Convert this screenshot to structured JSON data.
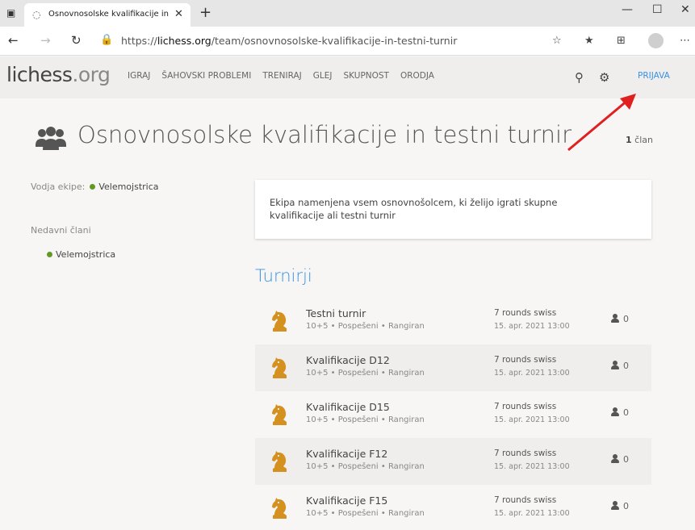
{
  "browser": {
    "tab_title": "Osnovnosolske kvalifikacije in testni turnir - lichess.org",
    "url_prefix": "https://",
    "url_host": "lichess.org",
    "url_path": "/team/osnovnosolske-kvalifikacije-in-testni-turnir",
    "icons": [
      "tab-actions-icon",
      "tab-favicon-icon",
      "close-icon",
      "plus-icon",
      "minimize-icon",
      "maximize-icon",
      "close-window-icon",
      "back-icon",
      "forward-icon",
      "refresh-icon",
      "lock-icon",
      "read-aloud-icon",
      "favorites-icon",
      "collections-icon",
      "profile-icon",
      "more-icon"
    ]
  },
  "header": {
    "logo_main": "lichess",
    "logo_tld": ".org",
    "nav": [
      "IGRAJ",
      "ŠAHOVSKI PROBLEMI",
      "TRENIRAJ",
      "GLEJ",
      "SKUPNOST",
      "ORODJA"
    ],
    "signin": "PRIJAVA"
  },
  "team": {
    "title": "Osnovnosolske kvalifikacije in testni turnir",
    "member_count": "1",
    "member_label": " član",
    "leader_label": "Vodja ekipe:",
    "leader_name": "Velemojstrica",
    "recent_label": "Nedavni člani",
    "recent_members": [
      "Velemojstrica"
    ],
    "description": "Ekipa namenjena vsem osnovnošolcem, ki želijo igrati skupne kvalifikacije ali testni turnir"
  },
  "tournaments": {
    "section_title": "Turnirji",
    "rows": [
      {
        "name": "Testni turnir",
        "sub": "10+5 • Pospešeni • Rangiran",
        "type": "7 rounds swiss",
        "date": "15. apr. 2021 13:00",
        "players": "0"
      },
      {
        "name": "Kvalifikacije D12",
        "sub": "10+5 • Pospešeni • Rangiran",
        "type": "7 rounds swiss",
        "date": "15. apr. 2021 13:00",
        "players": "0"
      },
      {
        "name": "Kvalifikacije D15",
        "sub": "10+5 • Pospešeni • Rangiran",
        "type": "7 rounds swiss",
        "date": "15. apr. 2021 13:00",
        "players": "0"
      },
      {
        "name": "Kvalifikacije F12",
        "sub": "10+5 • Pospešeni • Rangiran",
        "type": "7 rounds swiss",
        "date": "15. apr. 2021 13:00",
        "players": "0"
      },
      {
        "name": "Kvalifikacije F15",
        "sub": "10+5 • Pospešeni • Rangiran",
        "type": "7 rounds swiss",
        "date": "15. apr. 2021 13:00",
        "players": "0"
      }
    ]
  },
  "colors": {
    "accent": "#3692e7",
    "online_dot": "#629924",
    "horse_icon": "#d59120",
    "arrow": "#e02020"
  }
}
